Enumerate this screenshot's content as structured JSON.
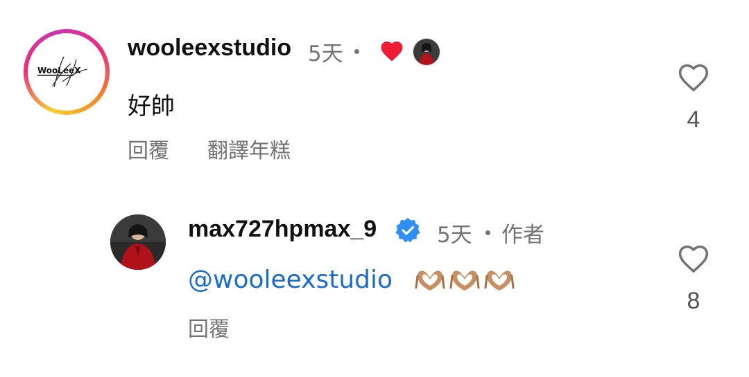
{
  "comments": [
    {
      "username": "wooleexstudio",
      "time": "5天",
      "text": "好帥",
      "actions": {
        "reply": "回覆",
        "translate": "翻譯年糕"
      },
      "likes": "4",
      "avatar_logo_text": "WooLeeX",
      "creator_liked": true
    },
    {
      "username": "max727hpmax_9",
      "time": "5天",
      "author_label": "作者",
      "verified": true,
      "mention": "@wooleexstudio",
      "emoji": [
        "heart-hands-emoji",
        "heart-hands-emoji",
        "heart-hands-emoji"
      ],
      "actions": {
        "reply": "回覆"
      },
      "likes": "8"
    }
  ],
  "colors": {
    "like_red": "#ed1b33",
    "verified_blue": "#2f8ef4",
    "mention_blue": "#1a6cd0",
    "muted_text": "#737373"
  }
}
